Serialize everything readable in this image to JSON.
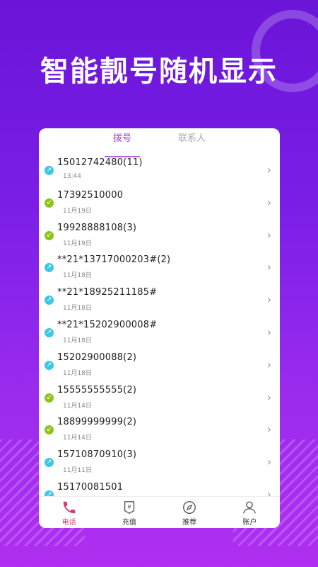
{
  "headline": "智能靓号随机显示",
  "tabs": [
    {
      "label": "拨号",
      "active": true
    },
    {
      "label": "联系人",
      "active": false
    }
  ],
  "calls": [
    {
      "number": "15012742480(11)",
      "time": "13:44",
      "direction": "out"
    },
    {
      "number": "17392510000",
      "time": "11月19日",
      "direction": "in"
    },
    {
      "number": "19928888108(3)",
      "time": "11月19日",
      "direction": "in"
    },
    {
      "number": "**21*13717000203#(2)",
      "time": "11月18日",
      "direction": "out"
    },
    {
      "number": "**21*18925211185#",
      "time": "11月18日",
      "direction": "out"
    },
    {
      "number": "**21*15202900008#",
      "time": "11月18日",
      "direction": "out"
    },
    {
      "number": "15202900088(2)",
      "time": "11月18日",
      "direction": "out"
    },
    {
      "number": "15555555555(2)",
      "time": "11月14日",
      "direction": "in"
    },
    {
      "number": "18899999999(2)",
      "time": "11月14日",
      "direction": "in"
    },
    {
      "number": "15710870910(3)",
      "time": "11月11日",
      "direction": "out"
    },
    {
      "number": "15170081501",
      "time": "",
      "direction": "out"
    }
  ],
  "nav": [
    {
      "label": "电话",
      "icon": "phone-icon",
      "active": true
    },
    {
      "label": "充值",
      "icon": "wallet-icon",
      "active": false
    },
    {
      "label": "推荐",
      "icon": "compass-icon",
      "active": false
    },
    {
      "label": "账户",
      "icon": "user-icon",
      "active": false
    }
  ],
  "colors": {
    "accent": "#a03bd6",
    "out": "#3cc6e8",
    "in": "#8cc41c",
    "nav_active": "#d63a74"
  }
}
